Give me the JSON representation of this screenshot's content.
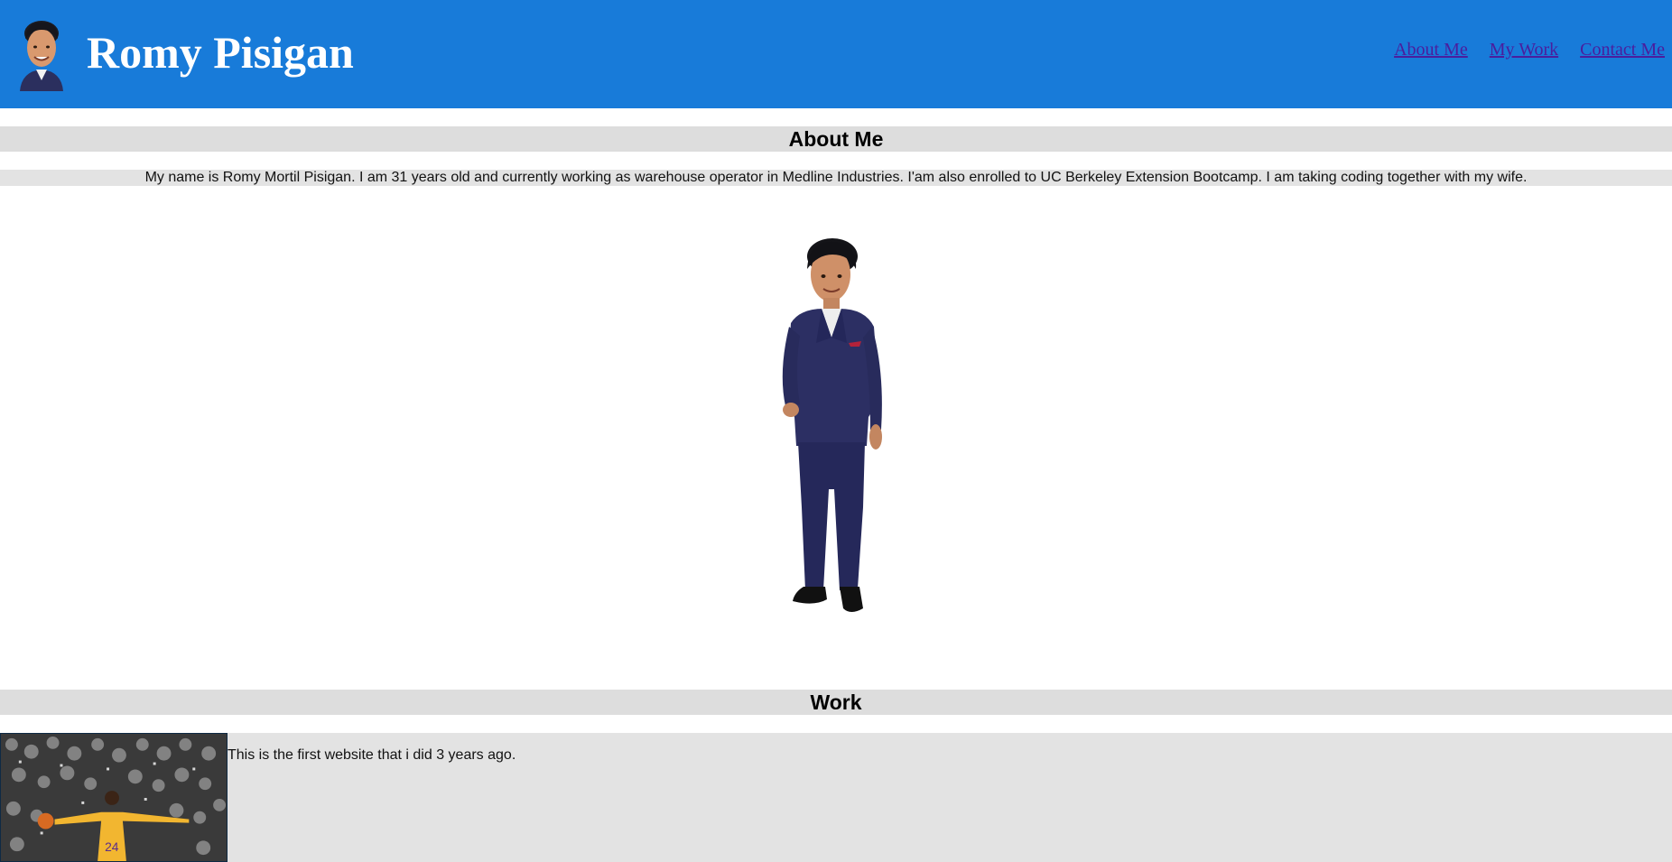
{
  "header": {
    "title": "Romy Pisigan",
    "background_color": "#187bd9",
    "avatar_icon": "avatar-face-icon",
    "nav": [
      {
        "label": "About Me"
      },
      {
        "label": "My Work"
      },
      {
        "label": "Contact Me"
      }
    ],
    "nav_link_color": "#4a1e9e"
  },
  "about": {
    "heading": "About Me",
    "text": "My name is Romy Mortil Pisigan. I am 31 years old and currently working as warehouse operator in Medline Industries. I'am also enrolled to UC Berkeley Extension Bootcamp. I am taking coding together with my wife.",
    "image": "avatar-full-body-suit-icon"
  },
  "work": {
    "heading": "Work",
    "items": [
      {
        "image": "basketball-player-photo-icon",
        "description": "This is the first website that i did 3 years ago."
      }
    ]
  },
  "colors": {
    "section_bg": "#dddddd",
    "row_bg": "#e3e3e3"
  }
}
